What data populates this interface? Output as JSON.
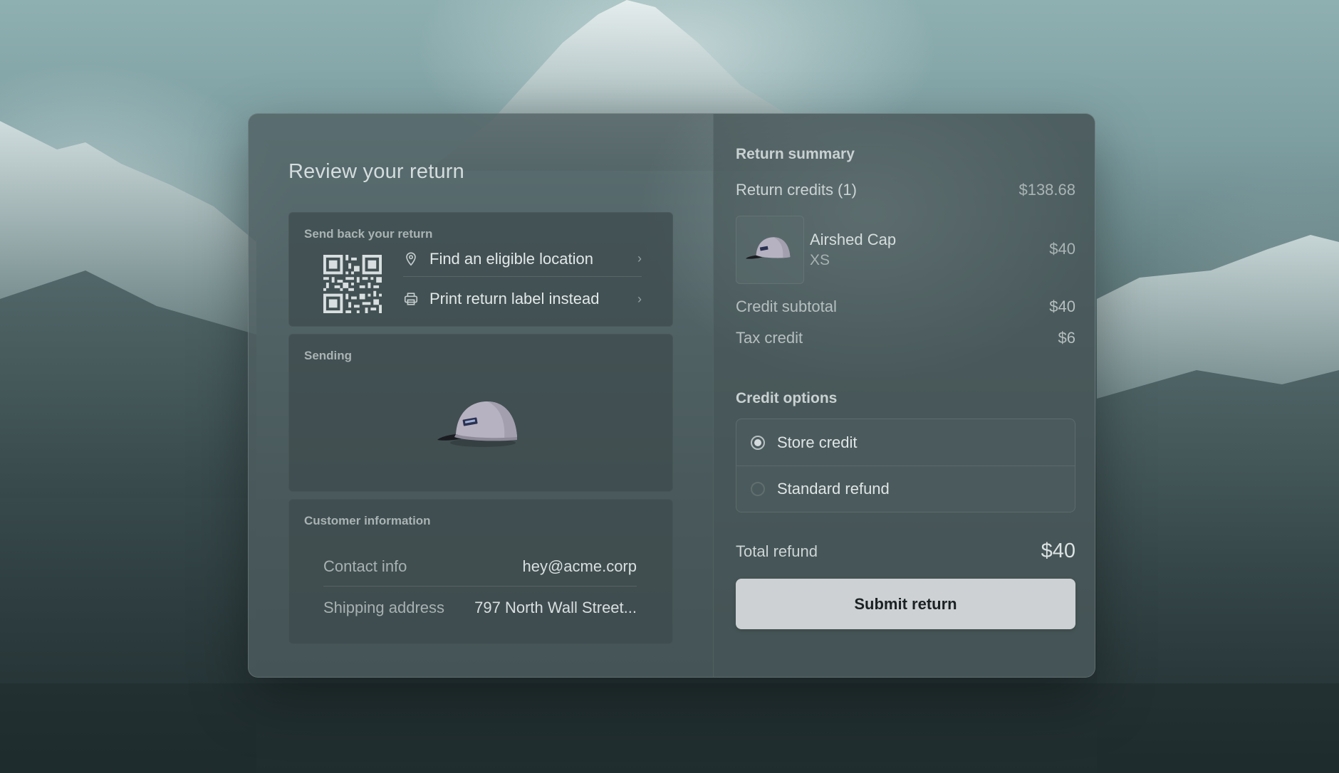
{
  "page": {
    "title": "Review your return"
  },
  "send_back": {
    "label": "Send back your return",
    "options": [
      {
        "label": "Find an eligible location",
        "icon": "map-pin-icon"
      },
      {
        "label": "Print return label instead",
        "icon": "printer-icon"
      }
    ],
    "qr_icon": "qr-code-icon"
  },
  "sending": {
    "label": "Sending",
    "image": "cap-image"
  },
  "customer": {
    "label": "Customer information",
    "rows": [
      {
        "key": "Contact info",
        "value": "hey@acme.corp"
      },
      {
        "key": "Shipping address",
        "value": "797 North Wall Street..."
      }
    ]
  },
  "summary": {
    "title": "Return summary",
    "credits_label": "Return credits (1)",
    "credits_value": "$138.68",
    "item": {
      "name": "Airshed Cap",
      "size": "XS",
      "price": "$40"
    },
    "subtotal_label": "Credit subtotal",
    "subtotal_value": "$40",
    "tax_label": "Tax credit",
    "tax_value": "$6"
  },
  "credit_options": {
    "title": "Credit options",
    "options": [
      {
        "label": "Store credit",
        "selected": true
      },
      {
        "label": "Standard refund",
        "selected": false
      }
    ]
  },
  "total": {
    "label": "Total refund",
    "value": "$40"
  },
  "submit_label": "Submit return",
  "colors": {
    "submit_bg": "#cdd1d3",
    "panel_bg": "#3e4b4d"
  }
}
